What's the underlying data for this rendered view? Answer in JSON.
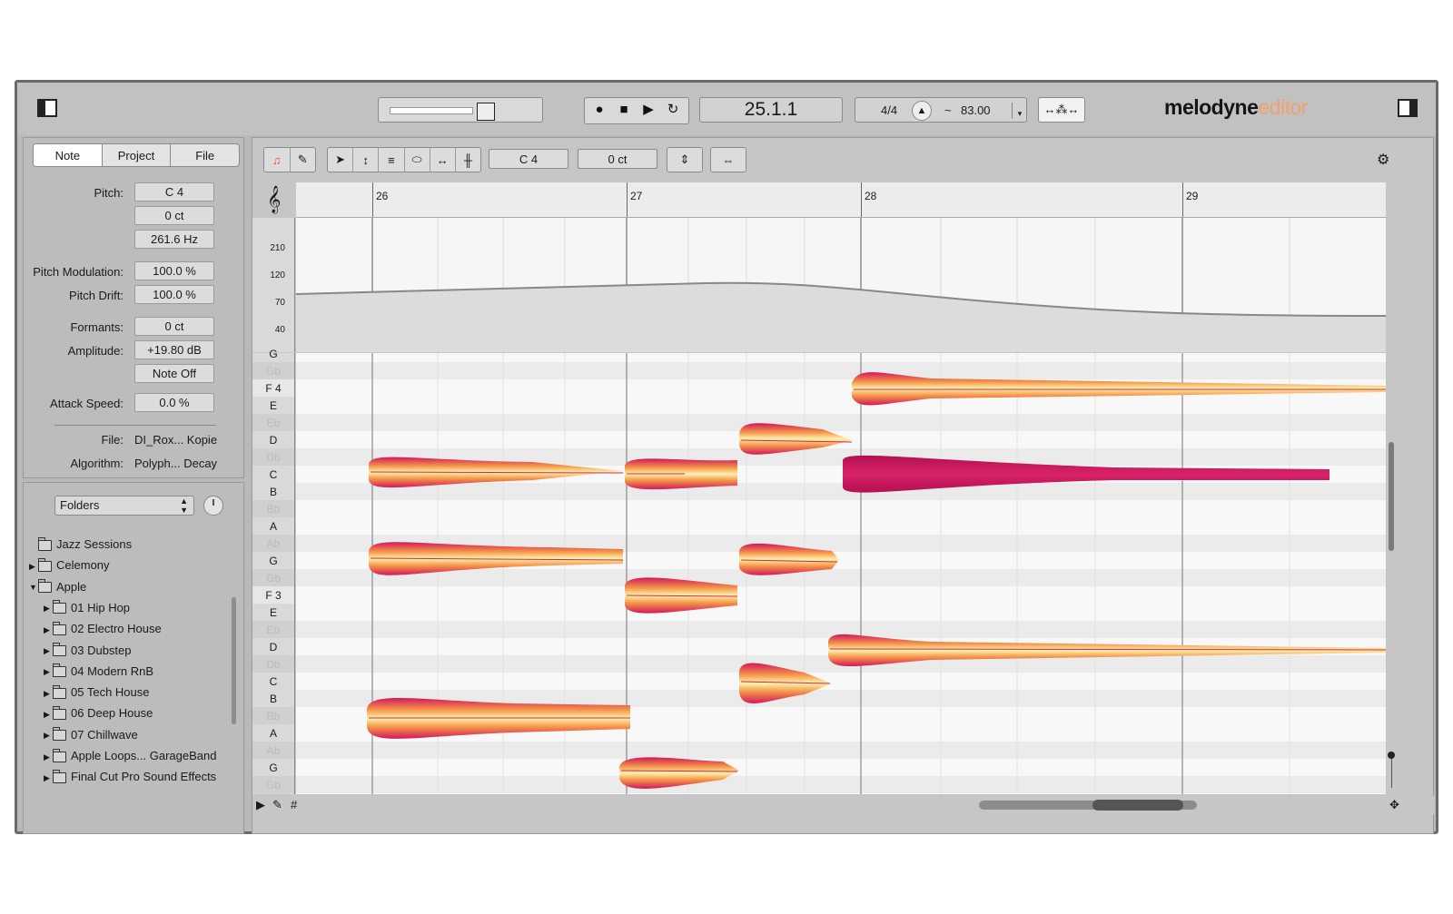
{
  "app": {
    "logo_main": "melodyne",
    "logo_sub": "editor"
  },
  "transport": {
    "position": "25.1.1",
    "time_signature": "4/4",
    "tempo_prefix": "~",
    "tempo": "83.00"
  },
  "inspector": {
    "tabs": [
      "Note",
      "Project",
      "File"
    ],
    "active_tab": "Note",
    "pitch_label": "Pitch:",
    "pitch_note": "C 4",
    "pitch_cents": "0 ct",
    "pitch_hz": "261.6 Hz",
    "pitch_mod_label": "Pitch Modulation:",
    "pitch_mod": "100.0 %",
    "pitch_drift_label": "Pitch Drift:",
    "pitch_drift": "100.0 %",
    "formants_label": "Formants:",
    "formants": "0 ct",
    "amplitude_label": "Amplitude:",
    "amplitude": "+19.80 dB",
    "note_off": "Note Off",
    "attack_label": "Attack Speed:",
    "attack": "0.0 %",
    "file_label": "File:",
    "file": "DI_Rox... Kopie",
    "algorithm_label": "Algorithm:",
    "algorithm": "Polyph... Decay"
  },
  "browser": {
    "select": "Folders",
    "items": [
      {
        "label": "Jazz Sessions",
        "level": 0,
        "arrow": ""
      },
      {
        "label": "Celemony",
        "level": 0,
        "arrow": "right"
      },
      {
        "label": "Apple",
        "level": 0,
        "arrow": "down"
      },
      {
        "label": "01 Hip Hop",
        "level": 1,
        "arrow": "right"
      },
      {
        "label": "02 Electro House",
        "level": 1,
        "arrow": "right"
      },
      {
        "label": "03 Dubstep",
        "level": 1,
        "arrow": "right"
      },
      {
        "label": "04 Modern RnB",
        "level": 1,
        "arrow": "right"
      },
      {
        "label": "05 Tech House",
        "level": 1,
        "arrow": "right"
      },
      {
        "label": "06 Deep House",
        "level": 1,
        "arrow": "right"
      },
      {
        "label": "07 Chillwave",
        "level": 1,
        "arrow": "right"
      },
      {
        "label": "Apple Loops... GarageBand",
        "level": 1,
        "arrow": "right"
      },
      {
        "label": "Final Cut Pro Sound Effects",
        "level": 1,
        "arrow": "right"
      }
    ]
  },
  "editor": {
    "note_field": "C 4",
    "cents_field": "0 ct",
    "bars": [
      "26",
      "27",
      "28",
      "29"
    ],
    "axis": [
      "210",
      "120",
      "70",
      "40"
    ],
    "keys": [
      "G",
      "Gb",
      "F 4",
      "E",
      "Eb",
      "D",
      "Db",
      "C",
      "B",
      "Bb",
      "A",
      "Ab",
      "G",
      "Gb",
      "F 3",
      "E",
      "Eb",
      "D",
      "Db",
      "C",
      "B",
      "Bb",
      "A",
      "Ab",
      "G",
      "Gb"
    ]
  }
}
